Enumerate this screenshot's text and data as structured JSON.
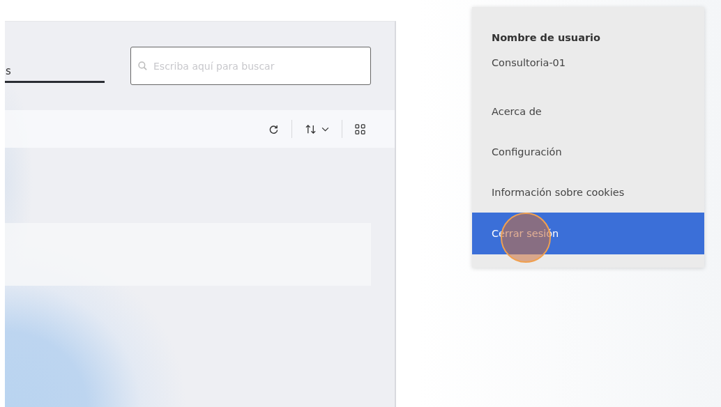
{
  "tabs": [
    {
      "label": "s",
      "selected": true
    }
  ],
  "search": {
    "placeholder": "Escriba aquí para buscar"
  },
  "user_menu": {
    "heading": "Nombre de usuario",
    "username": "Consultoria-01",
    "items": [
      {
        "label": "Acerca de",
        "selected": false
      },
      {
        "label": "Configuración",
        "selected": false
      },
      {
        "label": "Información sobre cookies",
        "selected": false
      },
      {
        "label": "Cerrar sesión",
        "selected": true
      }
    ]
  }
}
